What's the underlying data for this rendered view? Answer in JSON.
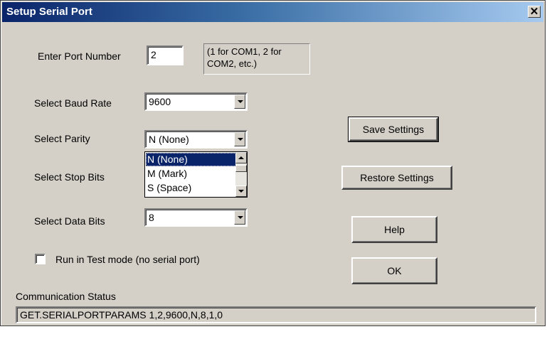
{
  "window": {
    "title": "Setup Serial Port",
    "close_glyph": "✕"
  },
  "port": {
    "label": "Enter Port Number",
    "value": "2",
    "hint_line1": "(1 for COM1, 2 for",
    "hint_line2": "COM2, etc.)"
  },
  "baud": {
    "label": "Select Baud Rate",
    "value": "9600"
  },
  "parity": {
    "label": "Select Parity",
    "value": "N (None)",
    "options": [
      "N (None)",
      "M (Mark)",
      "S (Space)"
    ],
    "highlighted_index": 0
  },
  "stopbits": {
    "label": "Select Stop Bits"
  },
  "databits": {
    "label": "Select Data Bits",
    "value": "8"
  },
  "testmode": {
    "label": "Run in Test mode (no serial port)",
    "checked": false
  },
  "buttons": {
    "save": "Save Settings",
    "restore": "Restore Settings",
    "help": "Help",
    "ok": "OK"
  },
  "status": {
    "label": "Communication Status",
    "value": "GET.SERIALPORTPARAMS 1,2,9600,N,8,1,0"
  }
}
